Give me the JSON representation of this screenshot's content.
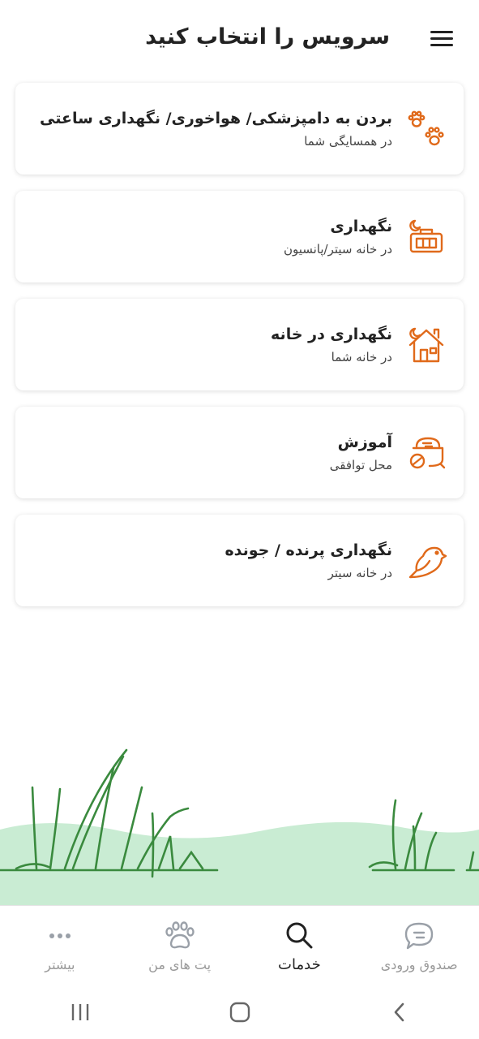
{
  "header": {
    "title": "سرویس را انتخاب کنید",
    "menu_icon": "hamburger-menu-icon"
  },
  "services": [
    {
      "title": "بردن به دامپزشکی/ هواخوری/ نگهداری ساعتی",
      "subtitle": "در همسایگی شما",
      "icon": "paws-icon"
    },
    {
      "title": "نگهداری",
      "subtitle": "در خانه سیتر/پانسیون",
      "icon": "pet-carrier-icon"
    },
    {
      "title": "نگهداری در خانه",
      "subtitle": "در خانه شما",
      "icon": "house-icon"
    },
    {
      "title": "آموزش",
      "subtitle": "محل توافقی",
      "icon": "food-bowl-icon"
    },
    {
      "title": "نگهداری پرنده / جونده",
      "subtitle": "در خانه سیتر",
      "icon": "bird-icon"
    }
  ],
  "bottom_nav": [
    {
      "label": "بیشتر",
      "icon": "more-dots-icon",
      "active": false
    },
    {
      "label": "پت های من",
      "icon": "paw-icon",
      "active": false
    },
    {
      "label": "خدمات",
      "icon": "search-icon",
      "active": true
    },
    {
      "label": "صندوق ورودی",
      "icon": "chat-bubble-icon",
      "active": false
    }
  ],
  "colors": {
    "accent": "#e06a1b",
    "grass": "#3a8a3e",
    "hill": "#c9ecd3",
    "text": "#222222",
    "muted": "#999999"
  }
}
